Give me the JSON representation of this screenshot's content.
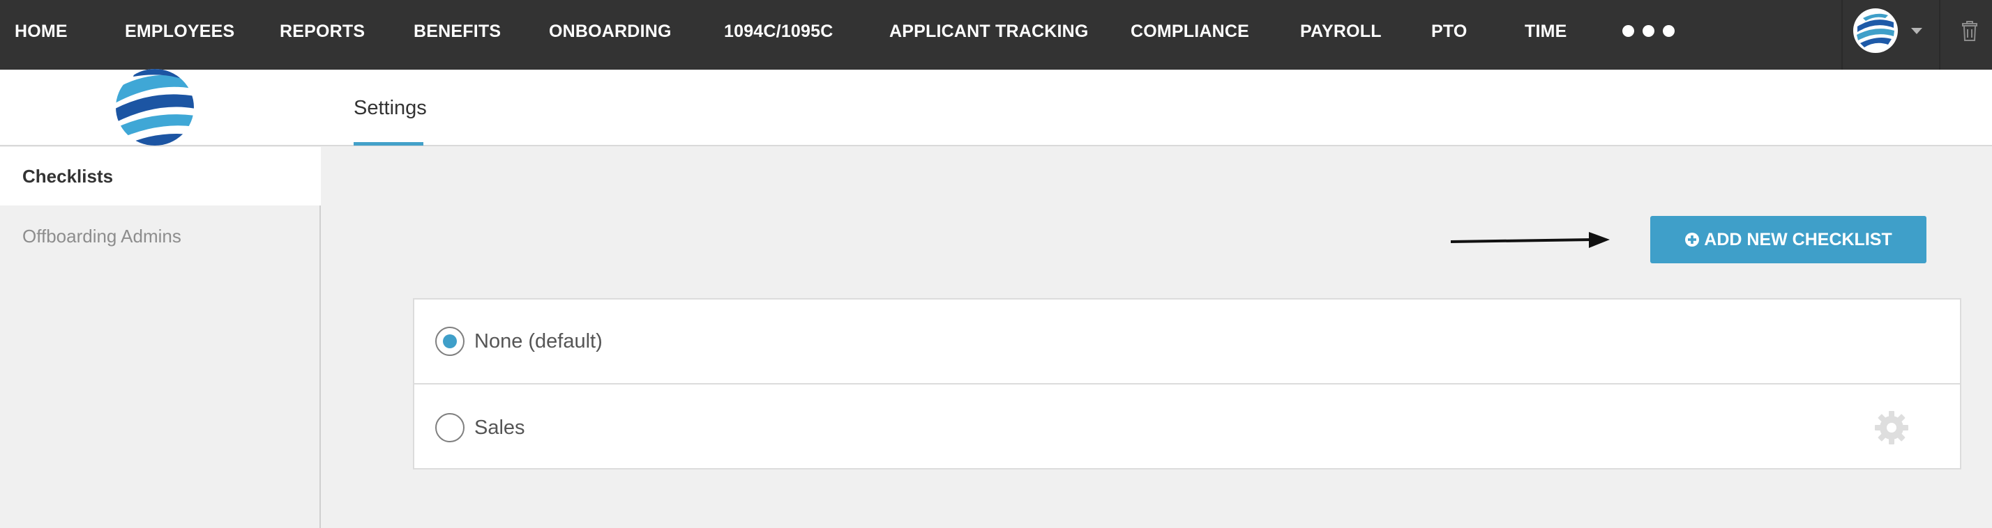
{
  "nav": {
    "items": [
      {
        "label": "HOME"
      },
      {
        "label": "EMPLOYEES"
      },
      {
        "label": "REPORTS"
      },
      {
        "label": "BENEFITS"
      },
      {
        "label": "ONBOARDING"
      },
      {
        "label": "1094C/1095C"
      },
      {
        "label": "APPLICANT TRACKING"
      },
      {
        "label": "COMPLIANCE"
      },
      {
        "label": "PAYROLL"
      },
      {
        "label": "PTO"
      },
      {
        "label": "TIME"
      }
    ],
    "more_icon": "ellipsis-icon",
    "avatar_icon": "globe-avatar-icon",
    "caret_icon": "caret-down-icon",
    "trash_icon": "trash-icon",
    "background_color": "#333333"
  },
  "subheader": {
    "logo_icon": "globe-logo-icon",
    "tab_label": "Settings",
    "accent_color": "#43a1c9"
  },
  "sidebar": {
    "items": [
      {
        "label": "Checklists",
        "active": true
      },
      {
        "label": "Offboarding Admins",
        "active": false
      }
    ]
  },
  "main": {
    "arrow_icon": "arrow-right-icon",
    "add_button": {
      "icon": "plus-circle-icon",
      "label": "ADD NEW CHECKLIST",
      "color": "#3f9fc9"
    },
    "checklists": [
      {
        "label": "None (default)",
        "selected": true
      },
      {
        "label": "Sales",
        "selected": false,
        "settings_icon": "gear-icon"
      }
    ]
  }
}
